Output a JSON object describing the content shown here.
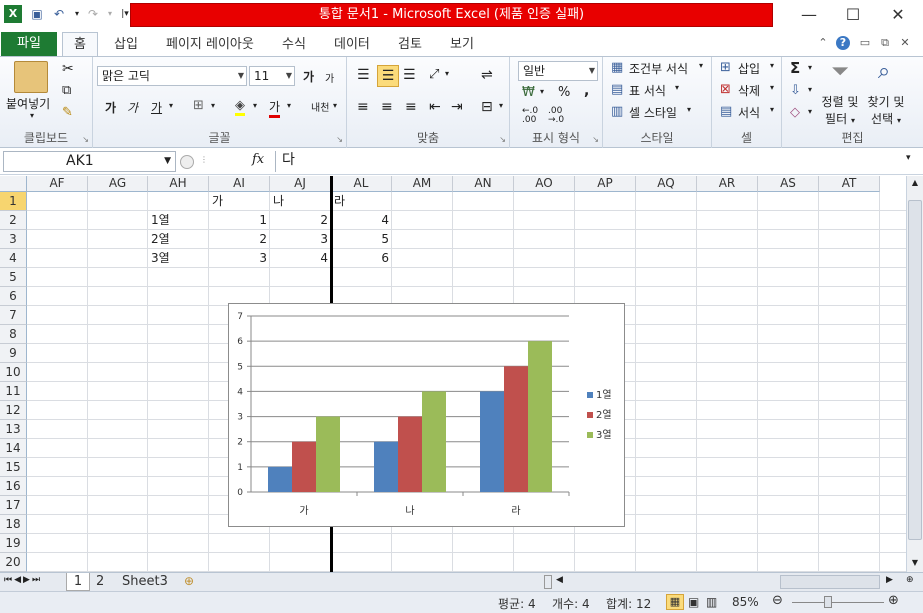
{
  "window": {
    "title": "통합 문서1  -  Microsoft Excel (제품 인증 실패)"
  },
  "tabs": [
    "파일",
    "홈",
    "삽입",
    "페이지 레이아웃",
    "수식",
    "데이터",
    "검토",
    "보기"
  ],
  "ribbon": {
    "clipboard": {
      "paste_label": "붙여넣기",
      "group": "클립보드"
    },
    "font": {
      "name": "맑은 고딕",
      "size": "11",
      "bold": "가",
      "italic": "가",
      "underline": "가",
      "big": "가",
      "small": "가",
      "fontcolor": "가",
      "phonetic": "내천",
      "group": "글꼴"
    },
    "alignment": {
      "group": "맞춤"
    },
    "number": {
      "format": "일반",
      "percent": "%",
      "comma": ",",
      "group": "표시 형식"
    },
    "styles": {
      "conditional": "조건부 서식",
      "table": "표 서식",
      "cell": "셀 스타일",
      "group": "스타일"
    },
    "cells": {
      "insert": "삽입",
      "delete": "삭제",
      "format": "서식",
      "group": "셀"
    },
    "editing": {
      "sigma": "Σ",
      "sort": "정렬 및\n필터",
      "sort1": "정렬 및",
      "sort2": "필터",
      "find1": "찾기 및",
      "find2": "선택",
      "group": "편집"
    }
  },
  "formula_bar": {
    "name_box": "AK1",
    "fx": "fx",
    "value": "다"
  },
  "columns": [
    "AF",
    "AG",
    "AH",
    "AI",
    "AJ",
    "AL",
    "AM",
    "AN",
    "AO",
    "AP",
    "AQ",
    "AR",
    "AS",
    "AT"
  ],
  "rows": [
    "1",
    "2",
    "3",
    "4",
    "5",
    "6",
    "7",
    "8",
    "9",
    "10",
    "11",
    "12",
    "13",
    "14",
    "15",
    "16",
    "17",
    "18",
    "19",
    "20"
  ],
  "cells": {
    "AI1": "가",
    "AJ1": "나",
    "AL1": "라",
    "AH2": "1열",
    "AI2": "1",
    "AJ2": "2",
    "AL2": "4",
    "AH3": "2열",
    "AI3": "2",
    "AJ3": "3",
    "AL3": "5",
    "AH4": "3열",
    "AI4": "3",
    "AJ4": "4",
    "AL4": "6"
  },
  "chart_data": {
    "type": "bar",
    "categories": [
      "가",
      "나",
      "라"
    ],
    "series": [
      {
        "name": "1열",
        "values": [
          1,
          2,
          4
        ],
        "color": "#4f81bd"
      },
      {
        "name": "2열",
        "values": [
          2,
          3,
          5
        ],
        "color": "#c0504d"
      },
      {
        "name": "3열",
        "values": [
          3,
          4,
          6
        ],
        "color": "#9bbb59"
      }
    ],
    "ylim": [
      0,
      7
    ],
    "yticks": [
      0,
      1,
      2,
      3,
      4,
      5,
      6,
      7
    ],
    "grid": true,
    "legend": "right"
  },
  "sheets": [
    "1",
    "2",
    "Sheet3"
  ],
  "status": {
    "average": "평균: 4",
    "count": "개수: 4",
    "sum": "합계: 12",
    "zoom": "85%"
  }
}
